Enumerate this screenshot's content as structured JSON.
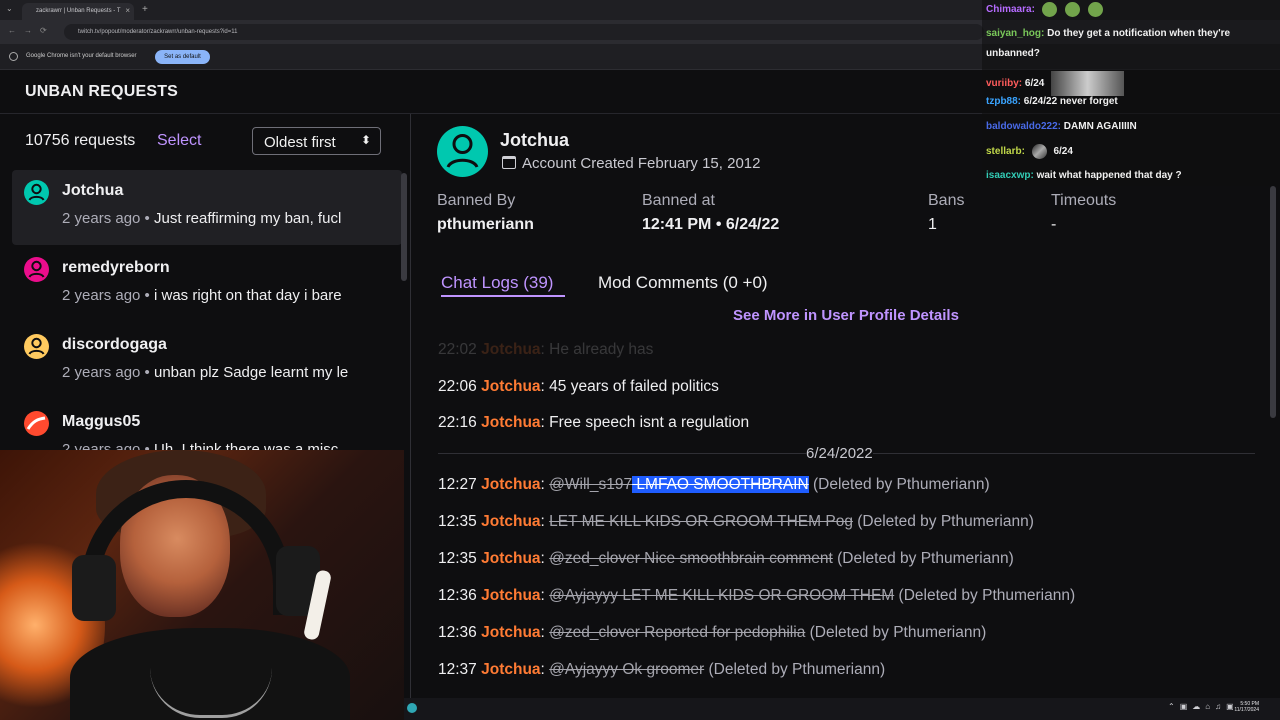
{
  "browser": {
    "tab_title": "zackrawrr | Unban Requests - T",
    "url": "twitch.tv/popout/moderator/zackrawrr/unban-requests?id=11",
    "infobar_text": "Google Chrome isn't your default browser",
    "infobar_button": "Set as default"
  },
  "page": {
    "title": "UNBAN REQUESTS",
    "request_count": "10756 requests",
    "select_label": "Select",
    "sort_label": "Oldest first"
  },
  "requests": [
    {
      "name": "Jotchua",
      "time": "2 years ago",
      "excerpt": "Just reaffirming my ban, fucl",
      "avatar_color": "#00c8af"
    },
    {
      "name": "remedyreborn",
      "time": "2 years ago",
      "excerpt": "i was right on that day i bare",
      "avatar_color": "#eb0d8c"
    },
    {
      "name": "discordogaga",
      "time": "2 years ago",
      "excerpt": "unban plz Sadge learnt my le",
      "avatar_color": "#ffca5f"
    },
    {
      "name": "Maggus05",
      "time": "2 years ago",
      "excerpt": "Uh, I think there was a misc",
      "avatar_color": "#ff4a2f"
    }
  ],
  "profile": {
    "name": "Jotchua",
    "created": "Account Created February 15, 2012",
    "avatar_color": "#00c8af",
    "banned_by_label": "Banned By",
    "banned_by": "pthumeriann",
    "banned_at_label": "Banned at",
    "banned_at": "12:41 PM • 6/24/22",
    "bans_label": "Bans",
    "bans": "1",
    "timeouts_label": "Timeouts",
    "timeouts": "-"
  },
  "tabs": {
    "chat_logs": "Chat Logs (39)",
    "mod_comments": "Mod Comments (0 +0)",
    "see_more": "See More in User Profile Details"
  },
  "logs": {
    "date_separator": "6/24/2022",
    "faded": {
      "time": "22:02",
      "user": "Jotchua",
      "message": "He already has"
    },
    "lines": [
      {
        "time": "22:06",
        "user": "Jotchua",
        "message": "45 years of failed politics",
        "deleted": false
      },
      {
        "time": "22:16",
        "user": "Jotchua",
        "message": "Free speech isnt a regulation",
        "deleted": false
      },
      {
        "time": "12:27",
        "user": "Jotchua",
        "message_prefix": "@Will_s197",
        "message_highlight": " LMFAO SMOOTHBRAIN",
        "deleted_note": "(Deleted by Pthumeriann)",
        "deleted": true
      },
      {
        "time": "12:35",
        "user": "Jotchua",
        "message": "LET ME KILL KIDS OR GROOM THEM Pog",
        "deleted_note": "(Deleted by Pthumeriann)",
        "deleted": true
      },
      {
        "time": "12:35",
        "user": "Jotchua",
        "message": "@zed_clover Nice smoothbrain comment",
        "deleted_note": "(Deleted by Pthumeriann)",
        "deleted": true
      },
      {
        "time": "12:36",
        "user": "Jotchua",
        "message": "@Ayjayyy LET ME KILL KIDS OR GROOM THEM",
        "deleted_note": "(Deleted by Pthumeriann)",
        "deleted": true
      },
      {
        "time": "12:36",
        "user": "Jotchua",
        "message": "@zed_clover Reported for pedophilia",
        "deleted_note": "(Deleted by Pthumeriann)",
        "deleted": true
      },
      {
        "time": "12:37",
        "user": "Jotchua",
        "message": "@Ayjayyy Ok groomer",
        "deleted_note": "(Deleted by Pthumeriann)",
        "deleted": true
      }
    ]
  },
  "chat_overlay": [
    {
      "user": "Chimaara:",
      "message": "",
      "color": "#b66cff"
    },
    {
      "user": "saiyan_hog:",
      "message": "Do they get a notification when they're",
      "color": "#7ac85a"
    },
    {
      "user": "",
      "message": "unbanned?",
      "color": "#7ac85a"
    },
    {
      "user": "vuriiby:",
      "message": "6/24",
      "color": "#ff5c5c"
    },
    {
      "user": "tzpb88:",
      "message": "6/24/22 never forget",
      "color": "#3aa4ff"
    },
    {
      "user": "baldowaldo222:",
      "message": "DAMN AGAIIIIN",
      "color": "#496ae7"
    },
    {
      "user": "stellarb:",
      "message": "6/24",
      "color": "#c1d84a"
    },
    {
      "user": "isaacxwp:",
      "message": "wait what happened that day ?",
      "color": "#33ccb6"
    }
  ],
  "taskbar": {
    "time": "5:50 PM",
    "date": "11/17/2024"
  }
}
